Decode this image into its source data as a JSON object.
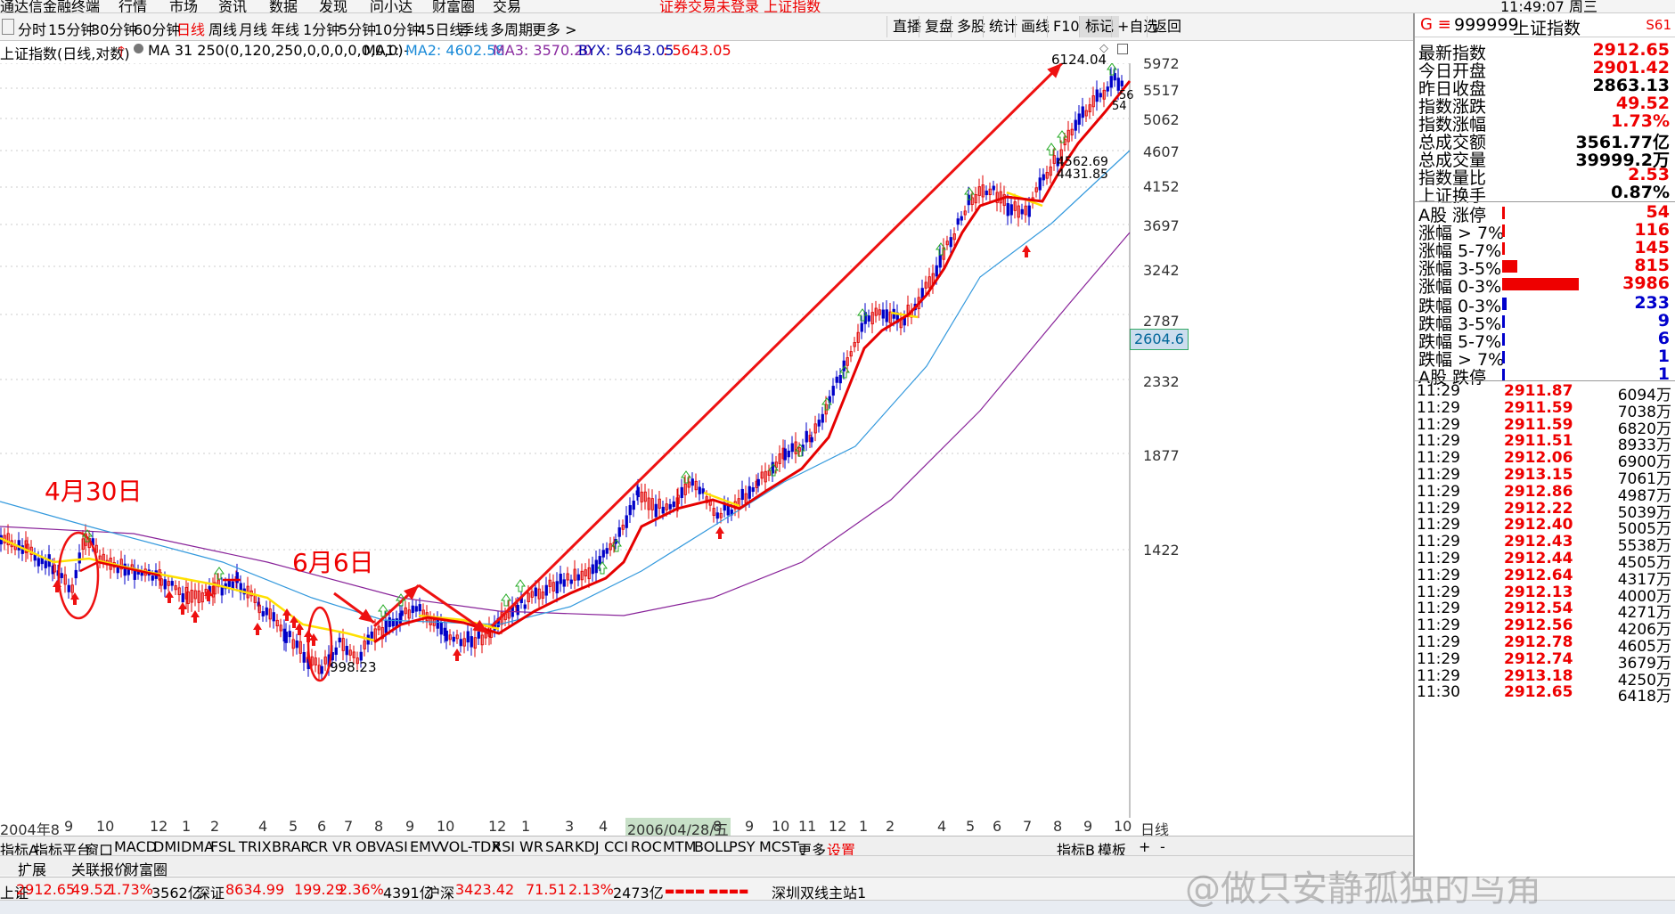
{
  "topmenu": {
    "items": [
      "通达信金融终端",
      "行情",
      "市场",
      "资讯",
      "数据",
      "发现",
      "问小达",
      "财富圈",
      "交易"
    ],
    "alert": "证券交易未登录 上证指数",
    "clock": "11:49:07 周三"
  },
  "periods": [
    "分时",
    "15分钟",
    "30分钟",
    "60分钟",
    "日线",
    "周线",
    "月线",
    "年线",
    "1分钟",
    "5分钟",
    "10分钟",
    "45日线",
    "季线",
    "多周期",
    "更多 >"
  ],
  "active_period": "日线",
  "toolbar_right": [
    "直播",
    "复盘",
    "多股",
    "统计",
    "画线",
    "F10",
    "标记",
    "+自选",
    "返回"
  ],
  "title": {
    "name": "上证指数(日线,对数)",
    "ma_label": "MA 31 250(0,120,250,0,0,0,0,0,0,0)",
    "ma1": "MA1: -",
    "ma2": "MA2: 4602.58",
    "ma3": "MA3: 3570.20",
    "byx": "BYX: 5643.05",
    "byx2": ": 5643.05"
  },
  "yaxis": [
    "5972",
    "5517",
    "5062",
    "4607",
    "4152",
    "3697",
    "3242",
    "2787",
    "2332",
    "1877",
    "1422"
  ],
  "cursor_price": "2604.6",
  "chart_labels": {
    "high": "6124.04",
    "low": "998.23",
    "ma_hint1": "4562.69",
    "ma_hint2": "4431.85",
    "small1": "56",
    "small2": "54"
  },
  "annotations": {
    "apr30": "4月30日",
    "jun6": "6月6日"
  },
  "xaxis": [
    "2004年8",
    "9",
    "10",
    "12",
    "1",
    "2",
    "4",
    "5",
    "6",
    "7",
    "8",
    "9",
    "10",
    "12",
    "1",
    "3",
    "4",
    "2006/04/28/五",
    "8",
    "9",
    "10",
    "11",
    "12",
    "1",
    "2",
    "4",
    "5",
    "6",
    "7",
    "8",
    "9",
    "10",
    "日线"
  ],
  "indicator_tabs": [
    "指标A",
    "指标平台",
    "窗口",
    "MACD",
    "DMI",
    "DMA",
    "FSL",
    "TRIX",
    "BRAR",
    "CR",
    "VR",
    "OBV",
    "ASI",
    "EMV",
    "VOL-TDX",
    "RSI",
    "WR",
    "SAR",
    "KDJ",
    "CCI",
    "ROC",
    "MTM",
    "BOLL",
    "PSY",
    "MCST",
    "更多",
    "设置"
  ],
  "indicator_tabs_right": [
    "指标B",
    "模板",
    "+",
    "-"
  ],
  "sub_tabs": [
    "扩展",
    "关联报价",
    "财富圈"
  ],
  "status": {
    "sh_label": "上证",
    "sh_val": "2912.65",
    "sh_chg": "49.52",
    "sh_pct": "1.73%",
    "sh_amt": "3562亿",
    "sz_label": "深证",
    "sz_val": "8634.99",
    "sz_chg": "199.29",
    "sz_pct": "2.36%",
    "sz_amt": "4391亿",
    "hs_label": "沪深",
    "hs_val": "3423.42",
    "hs_chg": "71.51",
    "hs_pct": "2.13%",
    "hs_amt": "2473亿",
    "site": "深圳双线主站1"
  },
  "right": {
    "header_code": "999999",
    "header_name": "上证指数",
    "header_tag": "S61",
    "stats": [
      {
        "label": "最新指数",
        "value": "2912.65",
        "color": "#e00"
      },
      {
        "label": "今日开盘",
        "value": "2901.42",
        "color": "#e00"
      },
      {
        "label": "昨日收盘",
        "value": "2863.13",
        "color": "#000"
      },
      {
        "label": "指数涨跌",
        "value": "49.52",
        "color": "#e00"
      },
      {
        "label": "指数涨幅",
        "value": "1.73%",
        "color": "#e00"
      },
      {
        "label": "总成交额",
        "value": "3561.77亿",
        "color": "#000"
      },
      {
        "label": "总成交量",
        "value": "39999.2万",
        "color": "#000"
      },
      {
        "label": "指数量比",
        "value": "2.53",
        "color": "#e00"
      },
      {
        "label": "上证换手",
        "value": "0.87%",
        "color": "#000"
      }
    ],
    "breadth": [
      {
        "label": "A股 涨停",
        "value": "54",
        "color": "#e00",
        "bar": 0.01
      },
      {
        "label": "涨幅 > 7%",
        "value": "116",
        "color": "#e00",
        "bar": 0.03
      },
      {
        "label": "涨幅 5-7%",
        "value": "145",
        "color": "#e00",
        "bar": 0.035
      },
      {
        "label": "涨幅 3-5%",
        "value": "815",
        "color": "#e00",
        "bar": 0.2
      },
      {
        "label": "涨幅 0-3%",
        "value": "3986",
        "color": "#e00",
        "bar": 1.0
      },
      {
        "label": "跌幅 0-3%",
        "value": "233",
        "color": "#00c",
        "bar": 0.06
      },
      {
        "label": "跌幅 3-5%",
        "value": "9",
        "color": "#00c",
        "bar": 0.005
      },
      {
        "label": "跌幅 5-7%",
        "value": "6",
        "color": "#00c",
        "bar": 0.004
      },
      {
        "label": "跌幅 > 7%",
        "value": "1",
        "color": "#00c",
        "bar": 0.002
      },
      {
        "label": "A股 跌停",
        "value": "1",
        "color": "#00c",
        "bar": 0.002
      }
    ],
    "ticks": [
      {
        "time": "11:29",
        "price": "2911.87",
        "vol": "6094万"
      },
      {
        "time": "11:29",
        "price": "2911.59",
        "vol": "7038万"
      },
      {
        "time": "11:29",
        "price": "2911.59",
        "vol": "6820万"
      },
      {
        "time": "11:29",
        "price": "2911.51",
        "vol": "8933万"
      },
      {
        "time": "11:29",
        "price": "2912.06",
        "vol": "6900万"
      },
      {
        "time": "11:29",
        "price": "2913.15",
        "vol": "7061万"
      },
      {
        "time": "11:29",
        "price": "2912.86",
        "vol": "4987万"
      },
      {
        "time": "11:29",
        "price": "2912.22",
        "vol": "5039万"
      },
      {
        "time": "11:29",
        "price": "2912.40",
        "vol": "5005万"
      },
      {
        "time": "11:29",
        "price": "2912.43",
        "vol": "5538万"
      },
      {
        "time": "11:29",
        "price": "2912.44",
        "vol": "4505万"
      },
      {
        "time": "11:29",
        "price": "2912.64",
        "vol": "4317万"
      },
      {
        "time": "11:29",
        "price": "2912.13",
        "vol": "4000万"
      },
      {
        "time": "11:29",
        "price": "2912.54",
        "vol": "4271万"
      },
      {
        "time": "11:29",
        "price": "2912.56",
        "vol": "4206万"
      },
      {
        "time": "11:29",
        "price": "2912.78",
        "vol": "4605万"
      },
      {
        "time": "11:29",
        "price": "2912.74",
        "vol": "3679万"
      },
      {
        "time": "11:29",
        "price": "2913.18",
        "vol": "4250万"
      },
      {
        "time": "11:30",
        "price": "2912.65",
        "vol": "6418万"
      }
    ]
  },
  "watermark": "@做只安静孤独的鸟角",
  "colors": {
    "up": "#e00000",
    "down": "#0000c8",
    "ma_red": "#e60000",
    "ma_blue": "#3399dd",
    "ma_purple": "#882299",
    "ma_yellow": "#ffe000"
  }
}
